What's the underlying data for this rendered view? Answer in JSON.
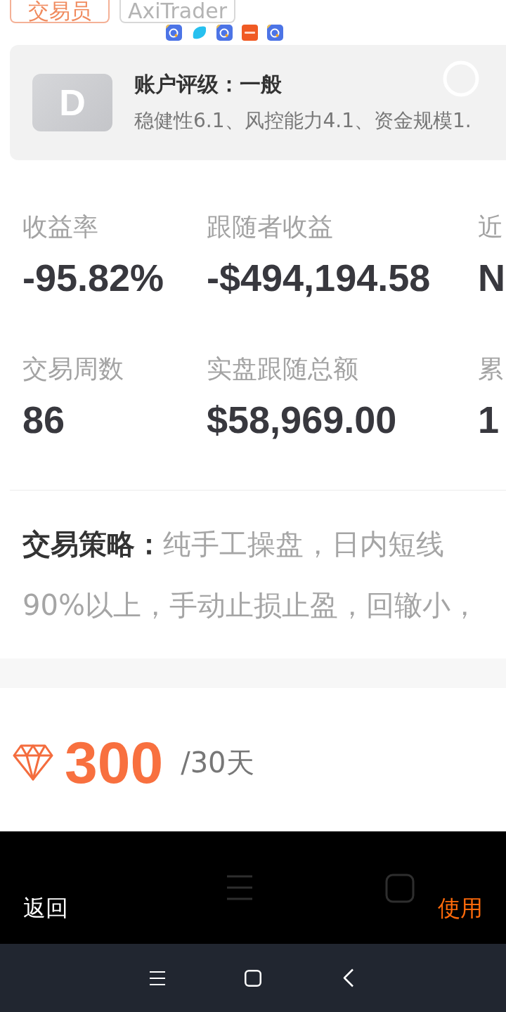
{
  "header": {
    "tags": [
      {
        "label": "交易员",
        "kind": "role"
      },
      {
        "label": "AxiTrader",
        "kind": "broker"
      }
    ]
  },
  "rating_card": {
    "grade": "D",
    "title": "账户评级：一般",
    "details": "稳健性6.1、风控能力4.1、资金规模1."
  },
  "stats": [
    {
      "label": "收益率",
      "value": "-95.82%"
    },
    {
      "label": "跟随者收益",
      "value": "-$494,194.58"
    },
    {
      "label": "近",
      "value": "N"
    },
    {
      "label": "交易周数",
      "value": "86"
    },
    {
      "label": "实盘跟随总额",
      "value": "$58,969.00"
    },
    {
      "label": "累",
      "value": "1"
    }
  ],
  "strategy": {
    "lines": [
      "**交易策略：**纯手工操盘，日内短线",
      "90%以上，手动止损止盈，回辙小，"
    ]
  },
  "price": {
    "amount": "300",
    "period": "/30天"
  },
  "action_bar": {
    "cancel": "返回",
    "confirm": "使用"
  }
}
